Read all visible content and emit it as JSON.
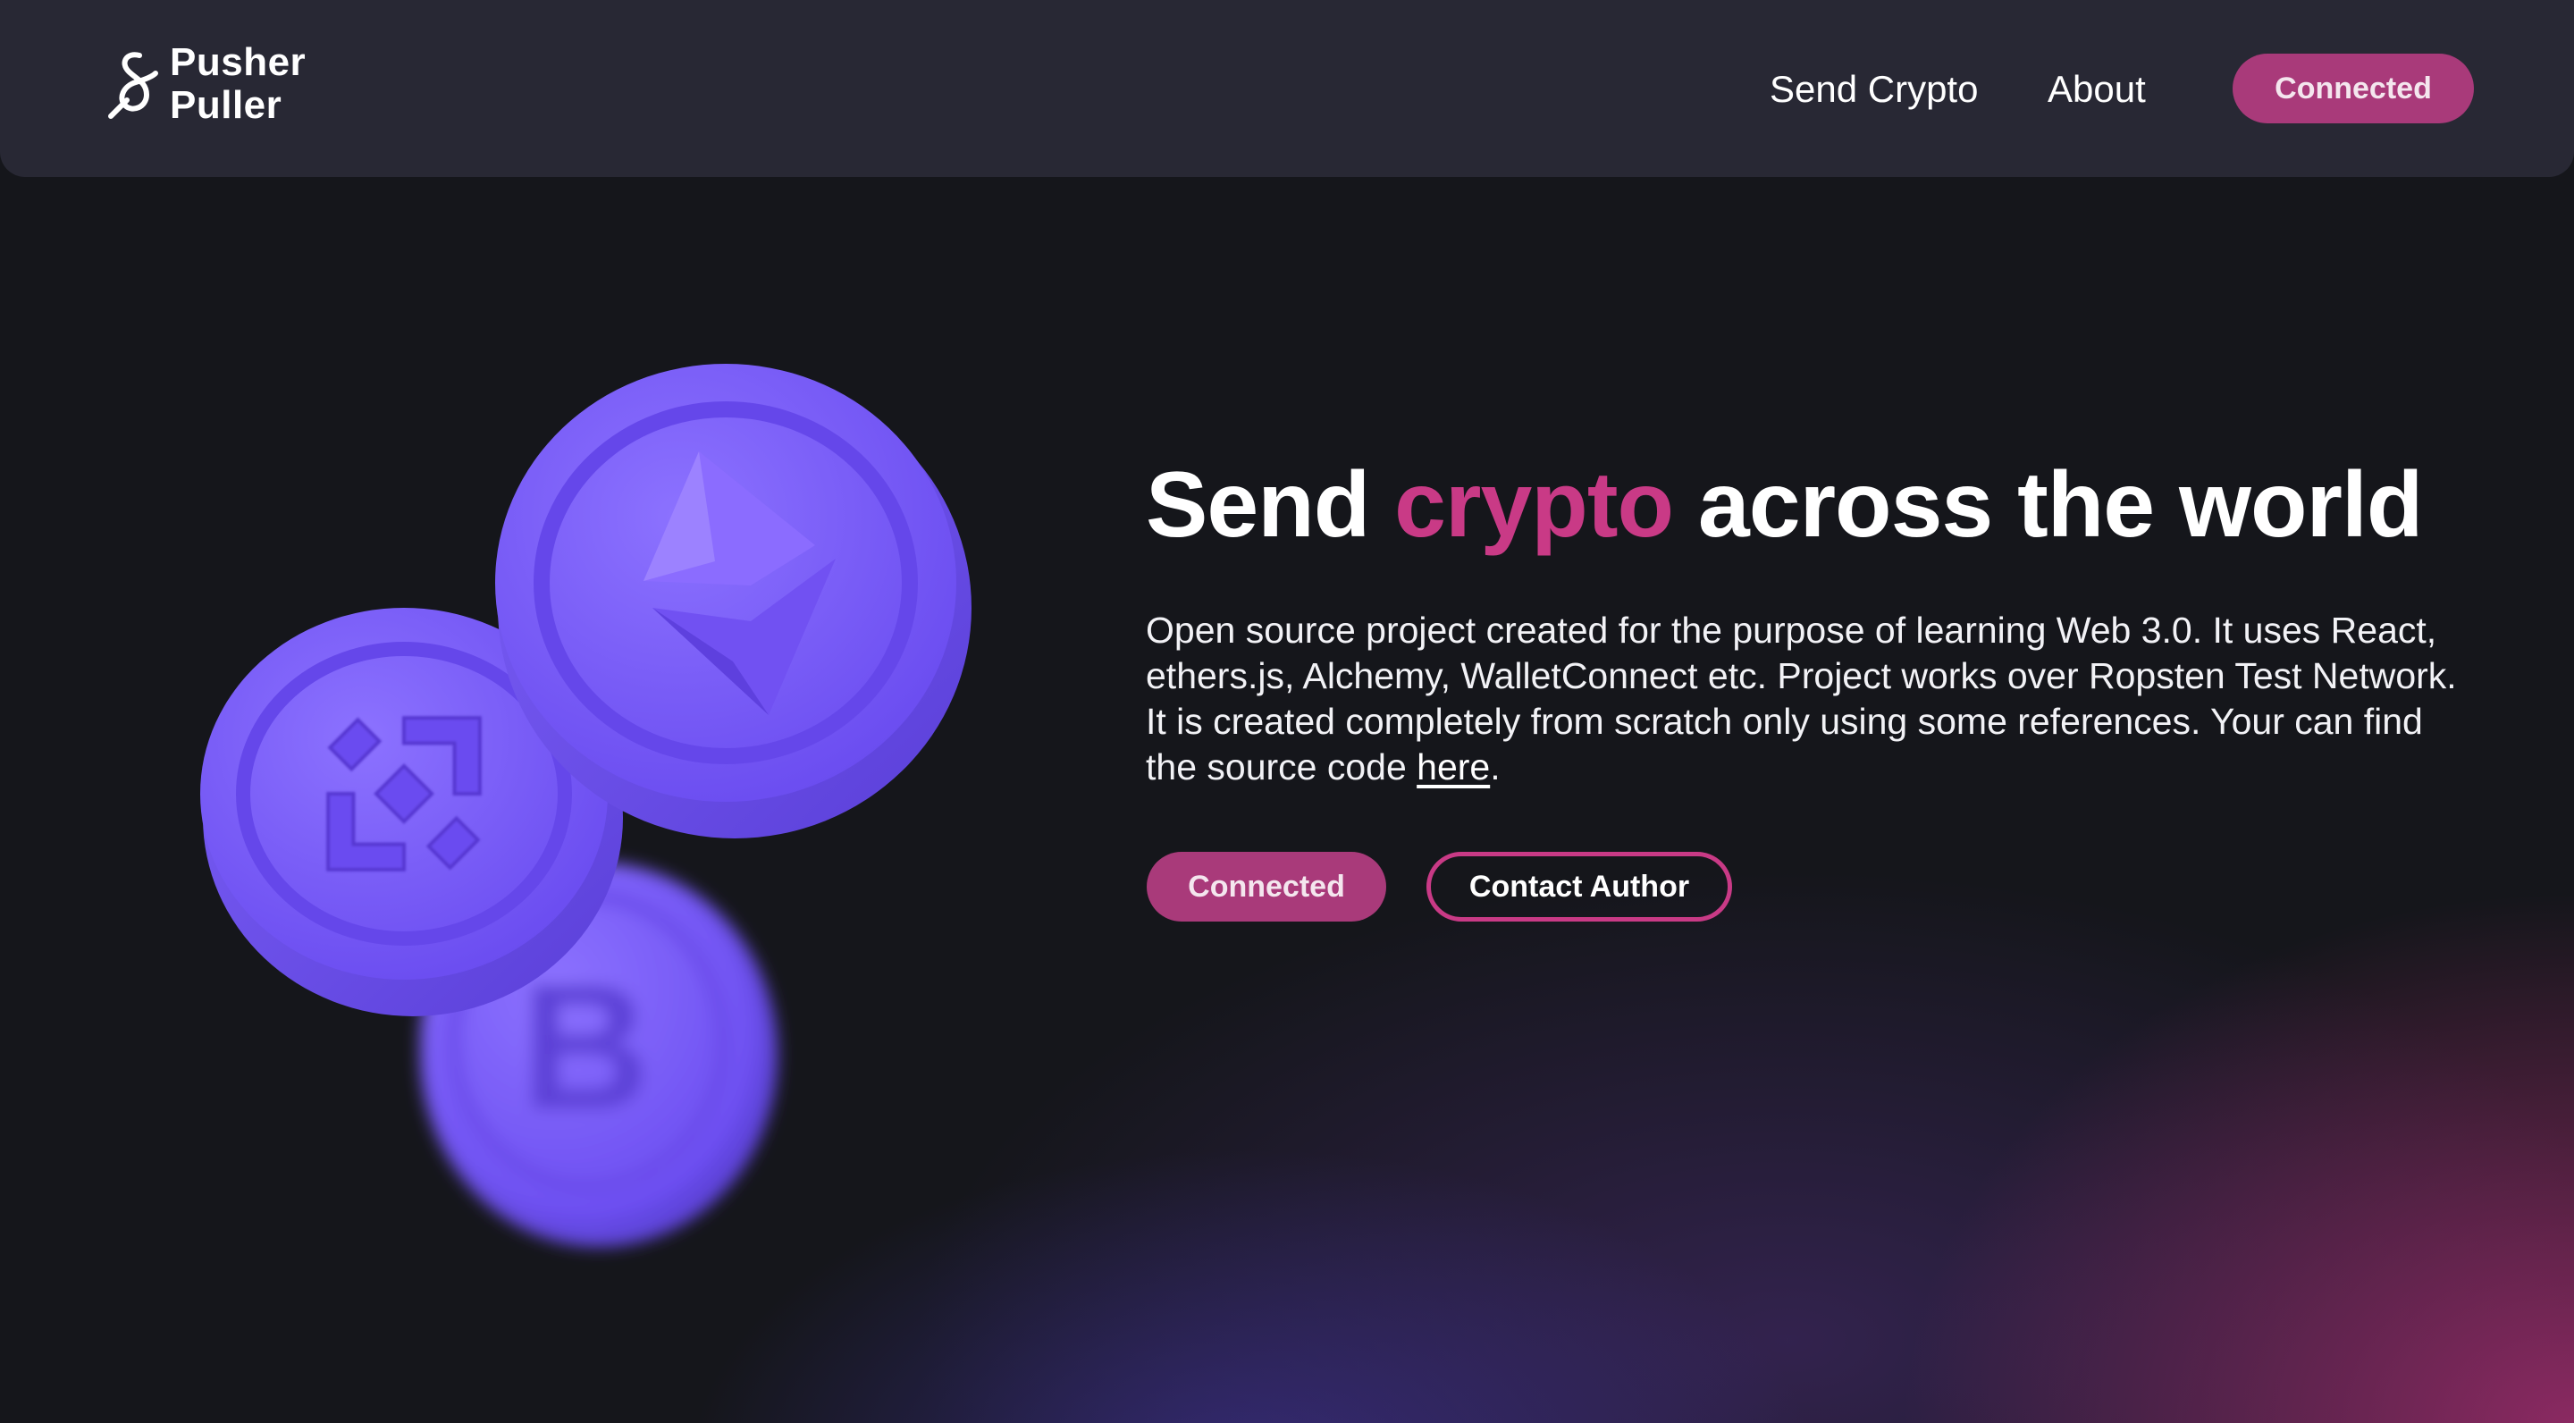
{
  "header": {
    "logo": {
      "line1": "Pusher",
      "line2": "Puller"
    },
    "nav": {
      "send_crypto": "Send Crypto",
      "about": "About",
      "connected": "Connected"
    }
  },
  "hero": {
    "headline": {
      "part1": "Send ",
      "accent": "crypto",
      "part2": " across the world"
    },
    "description": "Open source project created for the purpose of learning Web 3.0. It uses React, ethers.js, Alchemy, WalletConnect etc. Project works over Ropsten Test Network. It is created completely from scratch only using some references. Your can find the source code ",
    "description_link": "here",
    "description_end": ".",
    "buttons": {
      "connected": "Connected",
      "contact_author": "Contact Author"
    }
  },
  "illustration": {
    "coins": [
      "ethereum-coin-icon",
      "binance-coin-icon",
      "bitcoin-coin-icon"
    ]
  },
  "colors": {
    "accent": "#c93a86",
    "button_fill": "#a93a7a",
    "header_bg": "#282834",
    "page_bg": "#15161b",
    "coin_purple": "#7a5cf5"
  }
}
